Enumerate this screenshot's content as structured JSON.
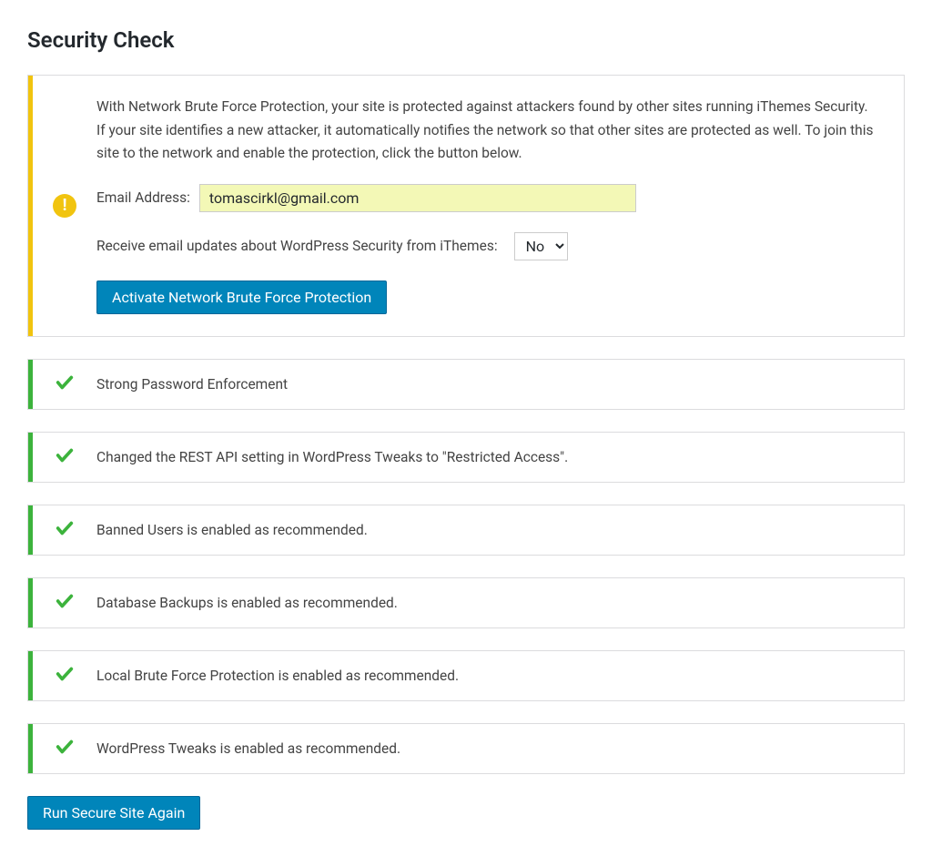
{
  "page_title": "Security Check",
  "warning_panel": {
    "description": "With Network Brute Force Protection, your site is protected against attackers found by other sites running iThemes Security. If your site identifies a new attacker, it automatically notifies the network so that other sites are protected as well. To join this site to the network and enable the protection, click the button below.",
    "email_label": "Email Address:",
    "email_value": "tomascirkl@gmail.com",
    "updates_label": "Receive email updates about WordPress Security from iThemes:",
    "updates_value": "No",
    "activate_button": "Activate Network Brute Force Protection"
  },
  "status_items": [
    {
      "text": "Strong Password Enforcement"
    },
    {
      "text": "Changed the REST API setting in WordPress Tweaks to \"Restricted Access\"."
    },
    {
      "text": "Banned Users is enabled as recommended."
    },
    {
      "text": "Database Backups is enabled as recommended."
    },
    {
      "text": "Local Brute Force Protection is enabled as recommended."
    },
    {
      "text": "WordPress Tweaks is enabled as recommended."
    }
  ],
  "footer_button": "Run Secure Site Again"
}
